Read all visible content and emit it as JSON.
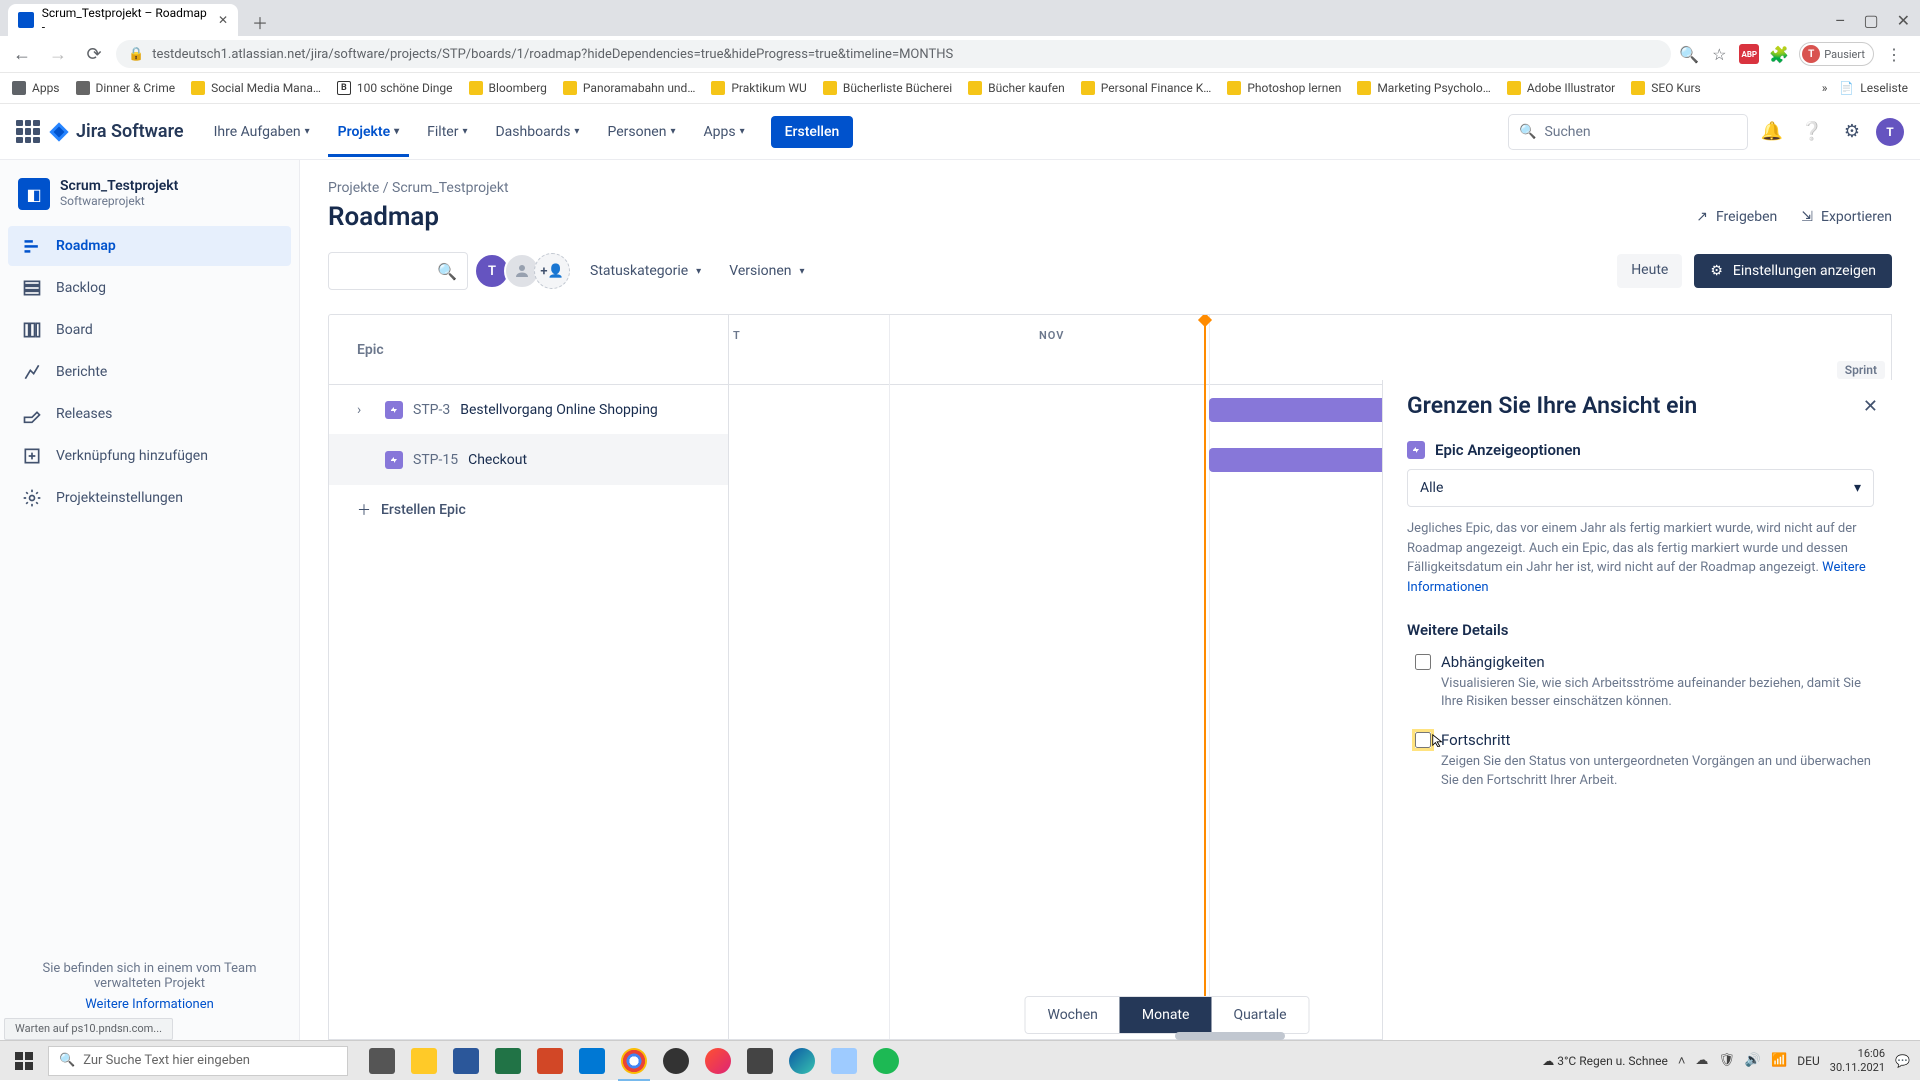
{
  "browser": {
    "tab_title": "Scrum_Testprojekt – Roadmap - ",
    "url": "testdeutsch1.atlassian.net/jira/software/projects/STP/boards/1/roadmap?hideDependencies=true&hideProgress=true&timeline=MONTHS",
    "profile_state": "Pausiert",
    "bookmarks": [
      "Apps",
      "Dinner & Crime",
      "Social Media Mana…",
      "100 schöne Dinge",
      "Bloomberg",
      "Panoramabahn und…",
      "Praktikum WU",
      "Bücherliste Bücherei",
      "Bücher kaufen",
      "Personal Finance K…",
      "Photoshop lernen",
      "Marketing Psycholo…",
      "Adobe Illustrator",
      "SEO Kurs"
    ],
    "reading_list": "Leseliste"
  },
  "window_controls": {
    "min": "–",
    "max": "▢",
    "close": "✕"
  },
  "header": {
    "app_name": "Jira Software",
    "nav": {
      "your_work": "Ihre Aufgaben",
      "projects": "Projekte",
      "filters": "Filter",
      "dashboards": "Dashboards",
      "people": "Personen",
      "apps": "Apps"
    },
    "create": "Erstellen",
    "search_placeholder": "Suchen"
  },
  "sidebar": {
    "project_name": "Scrum_Testprojekt",
    "project_type": "Softwareprojekt",
    "items": {
      "roadmap": "Roadmap",
      "backlog": "Backlog",
      "board": "Board",
      "reports": "Berichte",
      "releases": "Releases",
      "add_link": "Verknüpfung hinzufügen",
      "settings": "Projekteinstellungen"
    },
    "footer_text": "Sie befinden sich in einem vom Team verwalteten Projekt",
    "footer_link": "Weitere Informationen"
  },
  "breadcrumb": {
    "projects": "Projekte",
    "project": "Scrum_Testprojekt",
    "sep": " / "
  },
  "page": {
    "title": "Roadmap",
    "share": "Freigeben",
    "export": "Exportieren",
    "status_filter": "Statuskategorie",
    "versions_filter": "Versionen",
    "today": "Heute",
    "settings_btn": "Einstellungen anzeigen"
  },
  "roadmap": {
    "epic_header": "Epic",
    "months": {
      "oct_tail": "T",
      "nov": "NOV"
    },
    "sprint_label": "Sprint",
    "epics": [
      {
        "key": "STP-3",
        "title": "Bestellvorgang Online Shopping",
        "has_children": true
      },
      {
        "key": "STP-15",
        "title": "Checkout",
        "has_children": false
      }
    ],
    "create_epic": "Erstellen Epic",
    "zoom": {
      "weeks": "Wochen",
      "months": "Monate",
      "quarters": "Quartale"
    }
  },
  "panel": {
    "title": "Grenzen Sie Ihre Ansicht ein",
    "display_label": "Epic Anzeigeoptionen",
    "select_value": "Alle",
    "desc_text": "Jegliches Epic, das vor einem Jahr als fertig markiert wurde, wird nicht auf der Roadmap angezeigt. Auch ein Epic, das als fertig markiert wurde und dessen Fälligkeitsdatum ein Jahr her ist, wird nicht auf der Roadmap angezeigt. ",
    "more_info": "Weitere Informationen",
    "details_header": "Weitere Details",
    "dep_label": "Abhängigkeiten",
    "dep_desc": "Visualisieren Sie, wie sich Arbeitsströme aufeinander beziehen, damit Sie Ihre Risiken besser einschätzen können.",
    "prog_label": "Fortschritt",
    "prog_desc": "Zeigen Sie den Status von untergeordneten Vorgängen an und überwachen Sie den Fortschritt Ihrer Arbeit."
  },
  "status": {
    "text": "Warten auf ps10.pndsn.com..."
  },
  "taskbar": {
    "search_placeholder": "Zur Suche Text hier eingeben",
    "weather": "3°C  Regen u. Schnee",
    "lang": "DEU",
    "time": "16:06",
    "date": "30.11.2021"
  }
}
